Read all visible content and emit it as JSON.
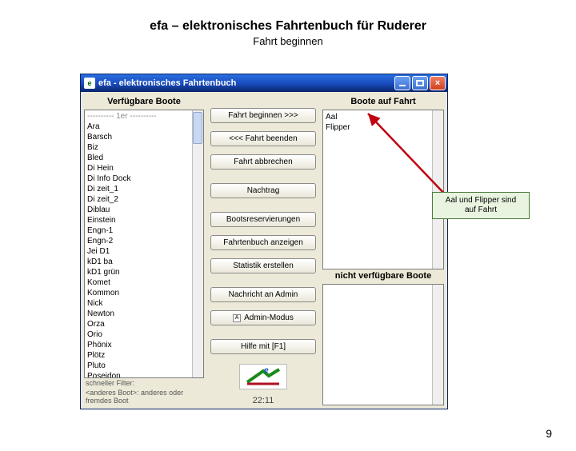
{
  "slide": {
    "title": "efa – elektronisches Fahrtenbuch für Ruderer",
    "subtitle": "Fahrt beginnen",
    "page_number": "9"
  },
  "window": {
    "title": "efa - elektronisches Fahrtenbuch"
  },
  "left_panel": {
    "header": "Verfügbare Boote",
    "first_item": "---------- 1er ----------",
    "items": [
      "Ara",
      "Barsch",
      "Biz",
      "Bled",
      "Di Hein",
      "Di Info Dock",
      "Di zeit_1",
      "Di zeit_2",
      "Diblau",
      "Einstein",
      "Engn-1",
      "Engn-2",
      "Jei D1",
      "kD1 ba",
      "kD1 grün",
      "Komet",
      "Kommon",
      "Nick",
      "Newton",
      "Orza",
      "Orio",
      "Phönix",
      "Plötz",
      "Pluto",
      "Poseidon"
    ],
    "footer_label": "schneller Filter:",
    "last_item": "<anderes Boot>: anderes oder fremdes Boot"
  },
  "mid": {
    "begin": "Fahrt beginnen >>>",
    "end": "<<< Fahrt beenden",
    "abort": "Fahrt abbrechen",
    "nachtrag": "Nachtrag",
    "reserv": "Bootsreservierungen",
    "show_fb": "Fahrtenbuch anzeigen",
    "stats": "Statistik erstellen",
    "msg_admin": "Nachricht an Admin",
    "admin_mode": "Admin-Modus",
    "help": "Hilfe mit [F1]",
    "clock": "22:11"
  },
  "right_top": {
    "header": "Boote auf Fahrt",
    "items": [
      "Aal",
      "Flipper"
    ]
  },
  "right_bottom": {
    "header": "nicht verfügbare Boote"
  },
  "callout": {
    "line1": "Aal und Flipper sind",
    "line2": "auf Fahrt"
  }
}
